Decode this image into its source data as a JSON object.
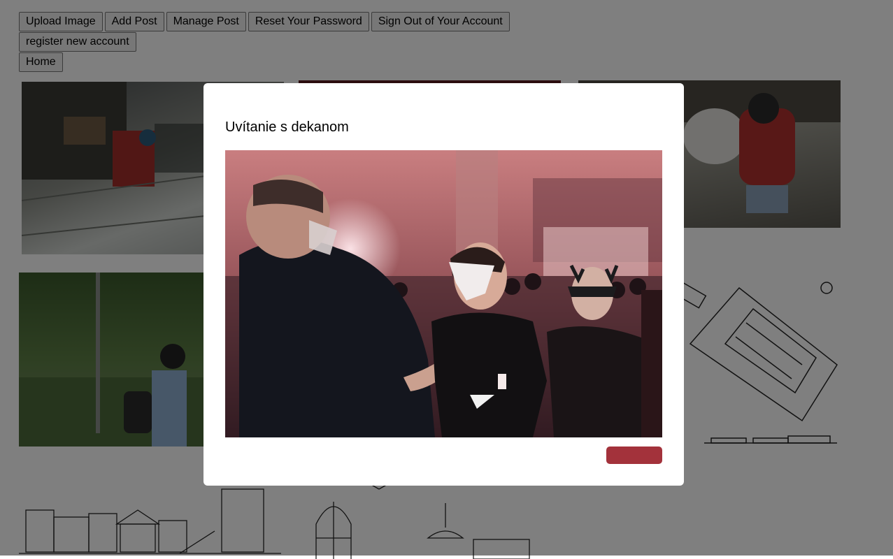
{
  "nav": {
    "upload_image": "Upload Image",
    "add_post": "Add Post",
    "manage_post": "Manage Post",
    "reset_password": "Reset Your Password",
    "sign_out": "Sign Out of Your Account",
    "register": "register new account",
    "home": "Home"
  },
  "modal": {
    "title": "Uvítanie s dekanom",
    "close_label": ""
  },
  "colors": {
    "accent": "#a3323b",
    "overlay": "rgba(0,0,0,0.5)"
  }
}
